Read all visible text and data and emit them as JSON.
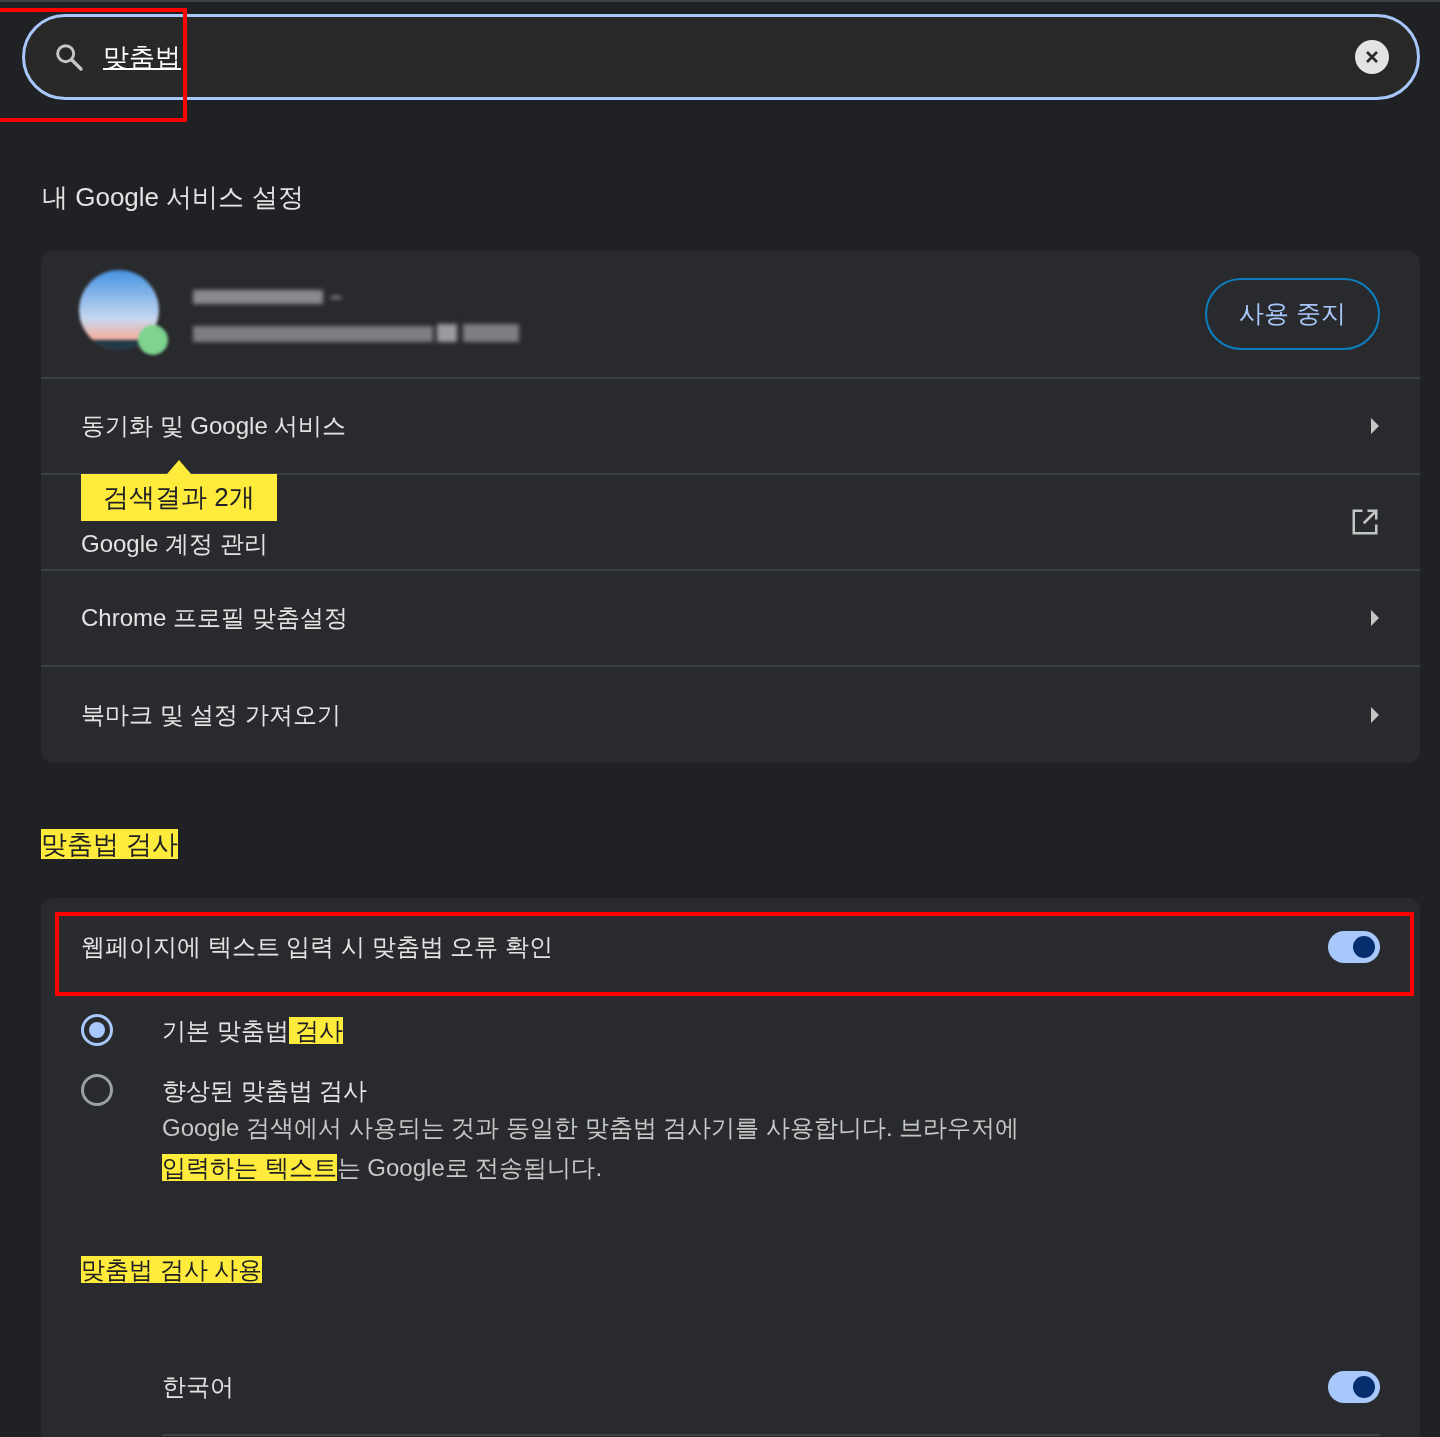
{
  "search": {
    "value": "맞춤법",
    "annotated": true
  },
  "google_section": {
    "title": "내 Google 서비스 설정",
    "account": {
      "kind": "picture",
      "button": "사용 중지"
    },
    "rows": [
      {
        "label": "동기화 및 Google 서비스",
        "kind": "arrow"
      },
      {
        "label": "Google 계정 관리",
        "kind": "external",
        "tooltip": "검색결과 2개"
      },
      {
        "label": "Chrome 프로필 맞춤설정",
        "kind": "arrow"
      },
      {
        "label": "북마크 및 설정 가져오기",
        "kind": "arrow"
      }
    ]
  },
  "spell_section": {
    "title": [
      {
        "text": "맞춤법 검사",
        "highlighted": true
      }
    ],
    "toggle": {
      "label": "웹페이지에 텍스트 입력 시 맞춤법 오류 확인",
      "on": true,
      "annotated": true
    },
    "options": [
      {
        "selected": true,
        "label": [
          {
            "text": "기본 맞춤법",
            "highlighted": false
          },
          {
            "text": " 검사",
            "highlighted": true
          }
        ]
      },
      {
        "selected": false,
        "label": [
          {
            "text": "향상된 맞춤법 검사",
            "highlighted": false
          }
        ],
        "description": [
          {
            "text": "Google 검색에서 사용되는 것과 동일한 맞춤법 검사기를 사용합니다. 브라우저에",
            "highlighted": false
          },
          {
            "text": " 입력하는 텍스트",
            "highlighted": true
          },
          {
            "text": "는 Google로 전송됩니다.",
            "highlighted": false
          }
        ]
      }
    ],
    "subtitle": [
      {
        "text": "맞춤법 검사 사용",
        "highlighted": true
      }
    ],
    "languages": [
      {
        "label": "한국어",
        "on": true
      }
    ]
  }
}
